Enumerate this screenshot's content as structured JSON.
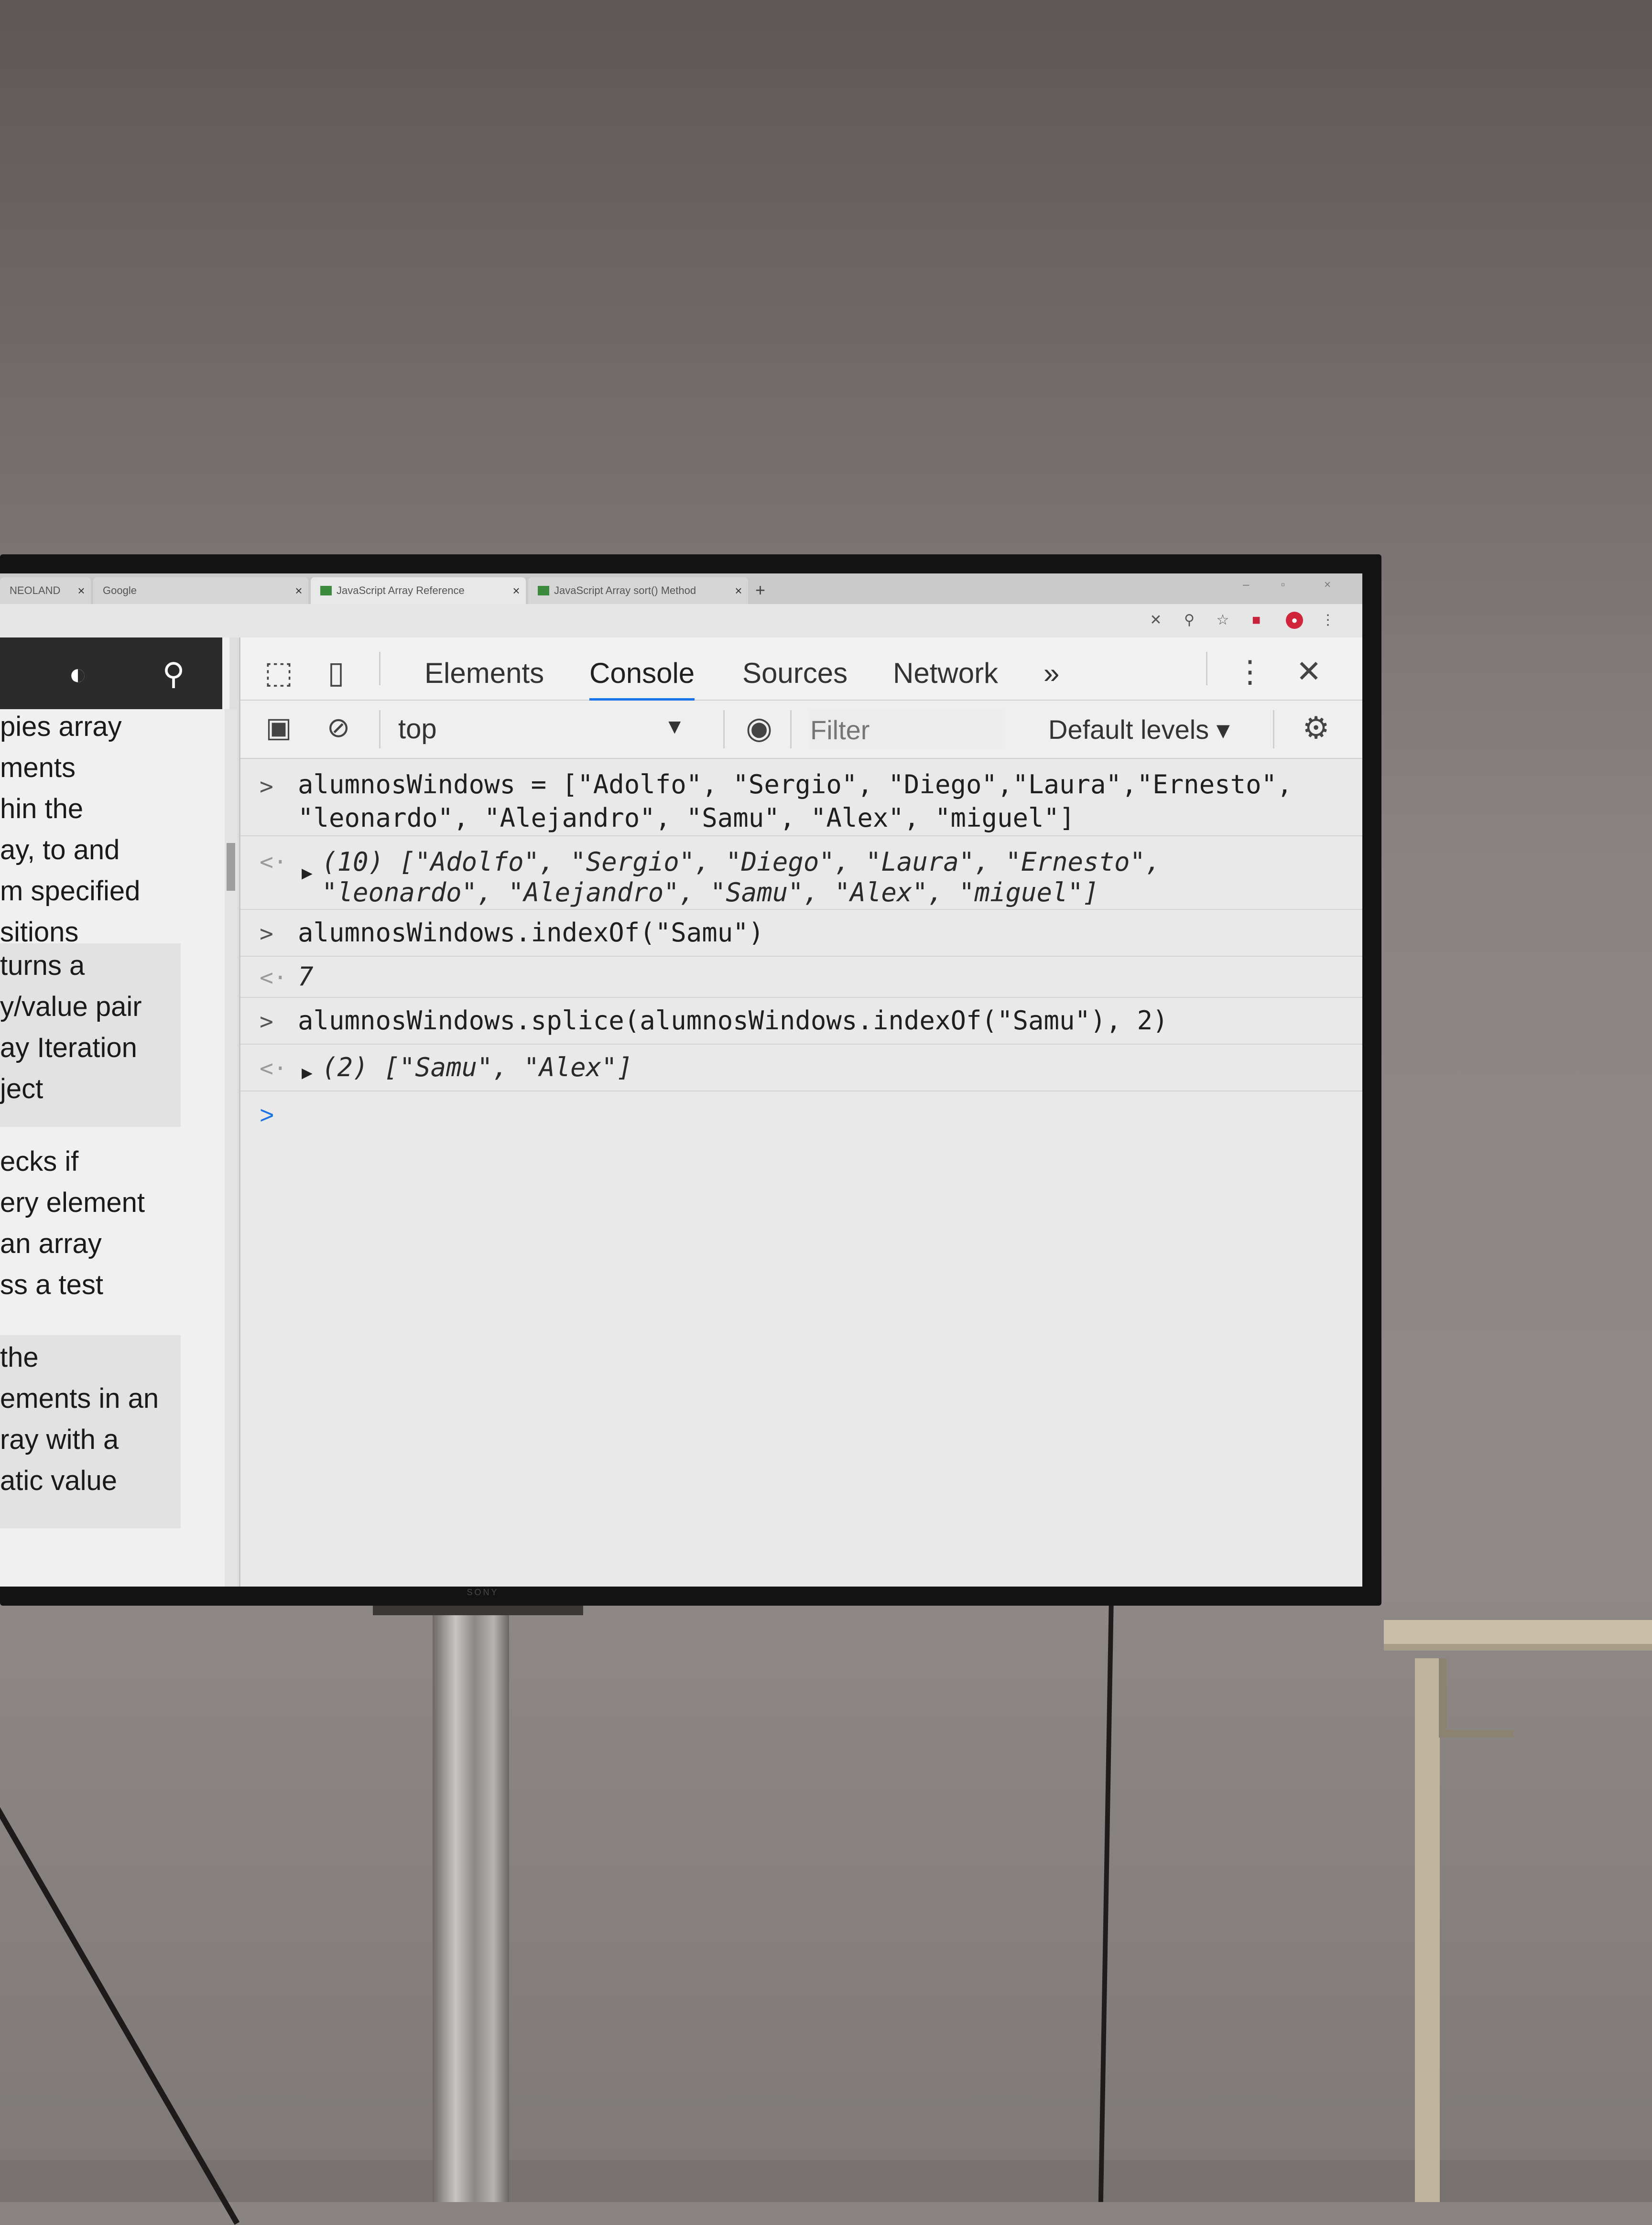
{
  "browser": {
    "tabs": [
      {
        "title": "NEOLAND",
        "close": "×"
      },
      {
        "title": "Google",
        "close": "×"
      },
      {
        "title": "JavaScript Array Reference",
        "close": "×"
      },
      {
        "title": "JavaScript Array sort() Method",
        "close": "×"
      }
    ],
    "new_tab": "+",
    "window_controls": [
      "–",
      "▫",
      "×"
    ]
  },
  "doc_page": {
    "blocks": [
      {
        "lines": [
          "pies array",
          "ments",
          "hin the",
          "ay, to and",
          "m specified",
          "sitions"
        ]
      },
      {
        "lines": [
          "turns a",
          "y/value pair",
          "ay Iteration",
          "ject"
        ]
      },
      {
        "lines": [
          "ecks if",
          "ery element",
          "an array",
          "ss a test"
        ]
      },
      {
        "lines": [
          "the",
          "ements in an",
          "ray with a",
          "atic value"
        ]
      }
    ]
  },
  "devtools": {
    "tabs": [
      "Elements",
      "Console",
      "Sources",
      "Network"
    ],
    "active_tab": "Console",
    "more_tabs": "»",
    "context": "top",
    "filter_placeholder": "Filter",
    "levels": "Default levels ▾",
    "close": "✕",
    "menu": "⋮"
  },
  "console": {
    "entries": [
      {
        "type": "input",
        "prefix": ">",
        "lines": [
          "alumnosWindows = [\"Adolfo\", \"Sergio\", \"Diego\",\"Laura\",\"Ernesto\",",
          "\"leonardo\", \"Alejandro\", \"Samu\", \"Alex\", \"miguel\"]"
        ]
      },
      {
        "type": "output",
        "prefix": "<·",
        "lines": [
          "(10) [\"Adolfo\", \"Sergio\", \"Diego\", \"Laura\", \"Ernesto\",",
          "\"leonardo\", \"Alejandro\", \"Samu\", \"Alex\", \"miguel\"]"
        ]
      },
      {
        "type": "input",
        "prefix": ">",
        "lines": [
          "alumnosWindows.indexOf(\"Samu\")"
        ]
      },
      {
        "type": "output",
        "prefix": "<·",
        "lines": [
          "7"
        ]
      },
      {
        "type": "input",
        "prefix": ">",
        "lines": [
          "alumnosWindows.splice(alumnosWindows.indexOf(\"Samu\"), 2)"
        ]
      },
      {
        "type": "output",
        "prefix": "<·",
        "lines": [
          "(2) [\"Samu\", \"Alex\"]"
        ]
      }
    ],
    "prompt": ">"
  },
  "monitor": {
    "brand": "SONY"
  }
}
